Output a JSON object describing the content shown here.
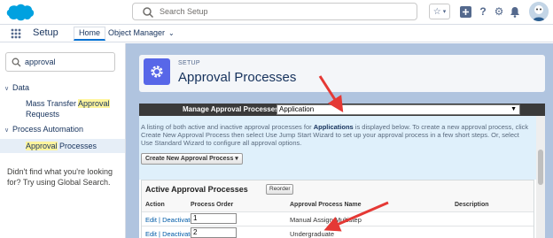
{
  "header": {
    "search_placeholder": "Search Setup"
  },
  "nav": {
    "app_name": "Setup",
    "tabs": [
      {
        "label": "Home"
      },
      {
        "label": "Object Manager"
      }
    ]
  },
  "sidebar": {
    "quickfind_value": "approval",
    "sections": [
      {
        "label": "Data",
        "items": [
          {
            "label_pre": "Mass Transfer ",
            "label_hl": "Approval",
            "label_post": "Requests"
          }
        ]
      },
      {
        "label": "Process Automation",
        "items": [
          {
            "label_pre": "",
            "label_hl": "Approval",
            "label_post": " Processes"
          }
        ]
      }
    ],
    "help_text": "Didn't find what you're looking for? Try using Global Search."
  },
  "page": {
    "eyebrow": "SETUP",
    "title": "Approval Processes"
  },
  "manage": {
    "label": "Manage Approval Processes For:",
    "selected": "Application"
  },
  "info": {
    "text_pre": "A listing of both active and inactive approval processes for ",
    "text_bold": "Applications",
    "text_post": " is displayed below. To create a new approval process, click Create New Approval Process then select Use Jump Start Wizard to set up your approval process in a few short steps. Or, select Use Standard Wizard to configure all approval options.",
    "create_button": "Create New Approval Process"
  },
  "active_processes": {
    "title": "Active Approval Processes",
    "reorder_button": "Reorder",
    "columns": [
      "Action",
      "Process Order",
      "Approval Process Name",
      "Description"
    ],
    "rows": [
      {
        "edit": "Edit",
        "sep": " | ",
        "deactivate": "Deactivate",
        "order": "1",
        "name": "Manual Assign Multistep"
      },
      {
        "edit": "Edit",
        "sep": " | ",
        "deactivate": "Deactivate",
        "order": "2",
        "name": "Undergraduate"
      }
    ]
  },
  "colors": {
    "header_bg": "#ffffff",
    "main_bg": "#b0c4df",
    "manage_bar": "#3a3a3a",
    "info_bg": "#dff0fb",
    "annotation_arrow": "#e53935",
    "highlight": "#fff59d",
    "link": "#015ba7"
  }
}
